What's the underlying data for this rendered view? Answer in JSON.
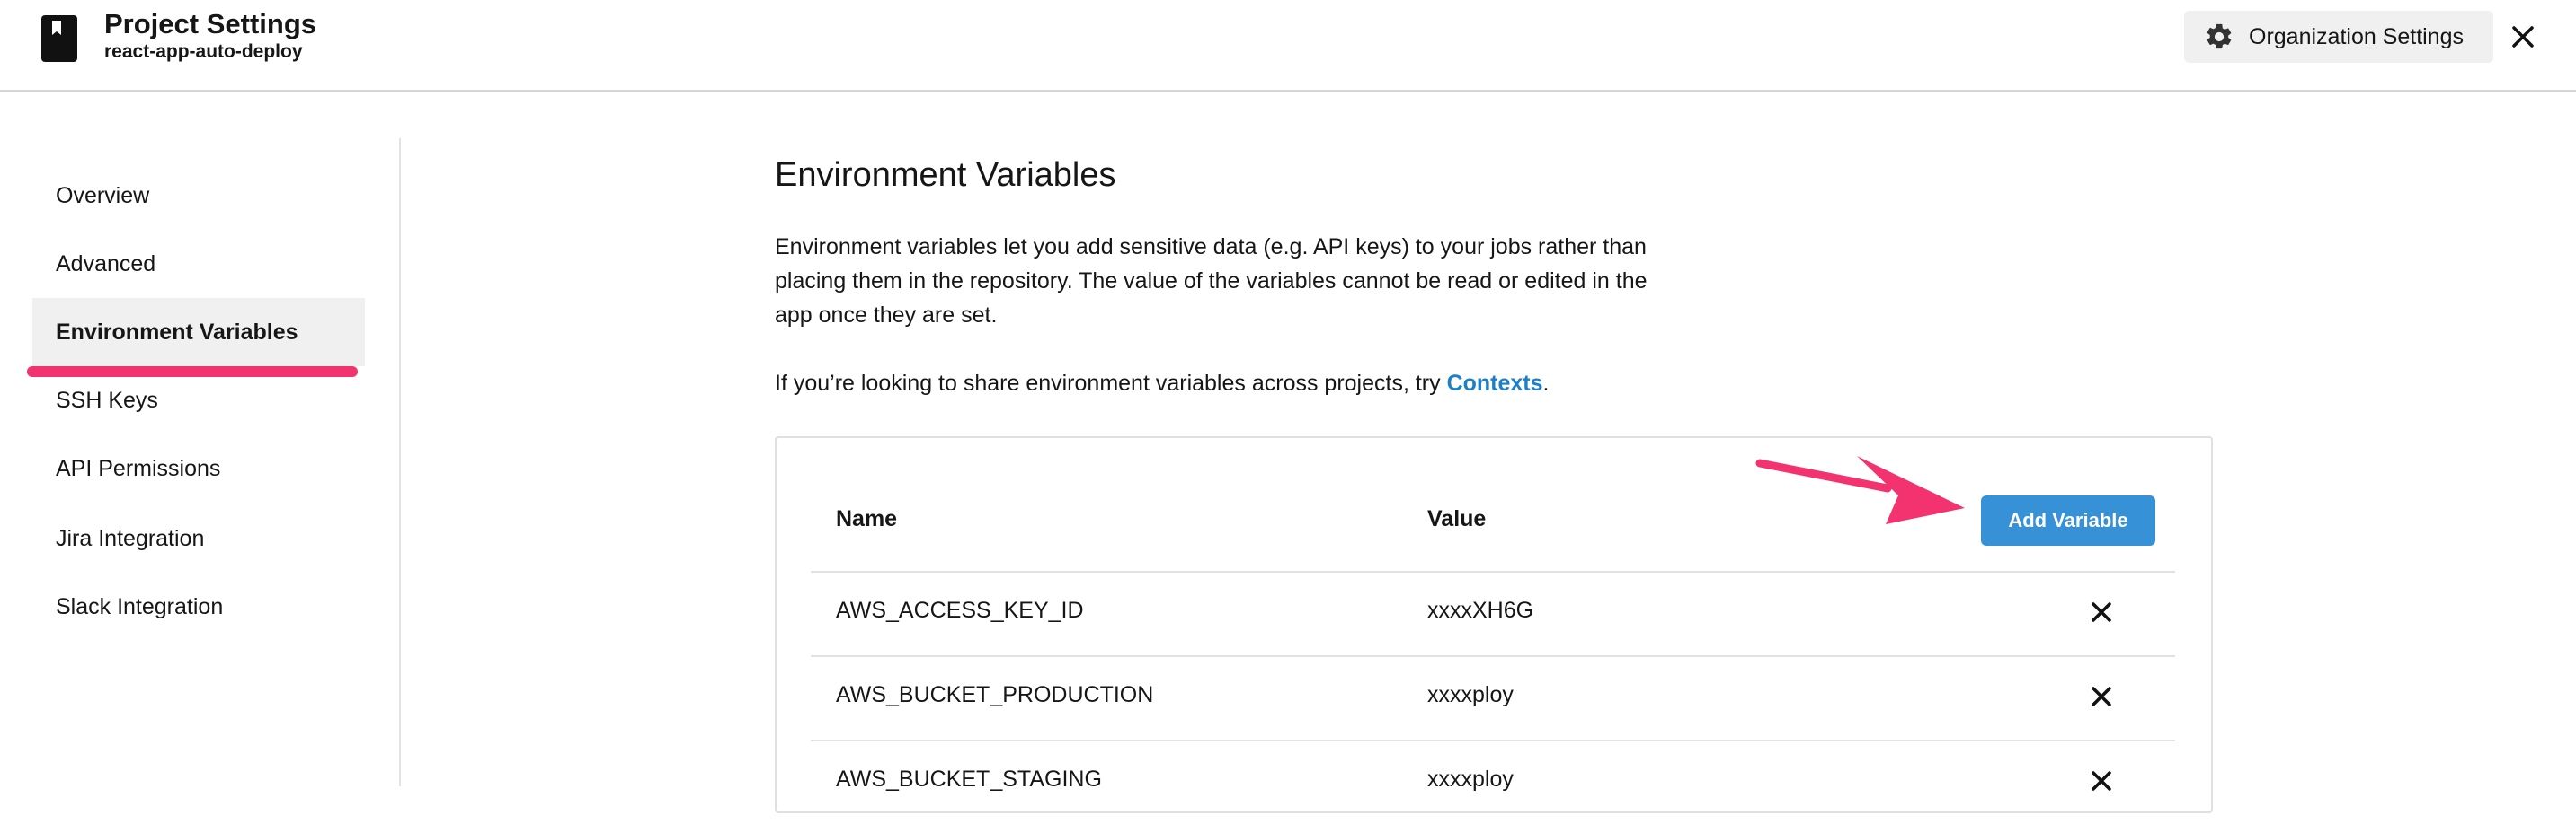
{
  "header": {
    "title": "Project Settings",
    "subtitle": "react-app-auto-deploy",
    "org_settings_label": "Organization Settings"
  },
  "sidebar": {
    "items": [
      {
        "label": "Overview"
      },
      {
        "label": "Advanced"
      },
      {
        "label": "Environment Variables"
      },
      {
        "label": "SSH Keys"
      },
      {
        "label": "API Permissions"
      },
      {
        "label": "Jira Integration"
      },
      {
        "label": "Slack Integration"
      }
    ],
    "active_index": 2
  },
  "main": {
    "title": "Environment Variables",
    "description": "Environment variables let you add sensitive data (e.g. API keys) to your jobs rather than placing them in the repository. The value of the variables cannot be read or edited in the app once they are set.",
    "contexts_prefix": "If you’re looking to share environment variables across projects, try ",
    "contexts_link": "Contexts",
    "contexts_suffix": ".",
    "table": {
      "name_header": "Name",
      "value_header": "Value",
      "add_button": "Add Variable",
      "rows": [
        {
          "name": "AWS_ACCESS_KEY_ID",
          "value": "xxxxXH6G"
        },
        {
          "name": "AWS_BUCKET_PRODUCTION",
          "value": "xxxxploy"
        },
        {
          "name": "AWS_BUCKET_STAGING",
          "value": "xxxxploy"
        }
      ]
    }
  },
  "colors": {
    "accent": "#f2336f",
    "primary_button": "#3691d7",
    "link": "#1c7fc7"
  },
  "icons": {
    "project": "bookmark-book-icon",
    "org_settings": "gear-icon",
    "close": "close-icon",
    "delete": "close-icon",
    "annotation": "arrow-annotation"
  }
}
